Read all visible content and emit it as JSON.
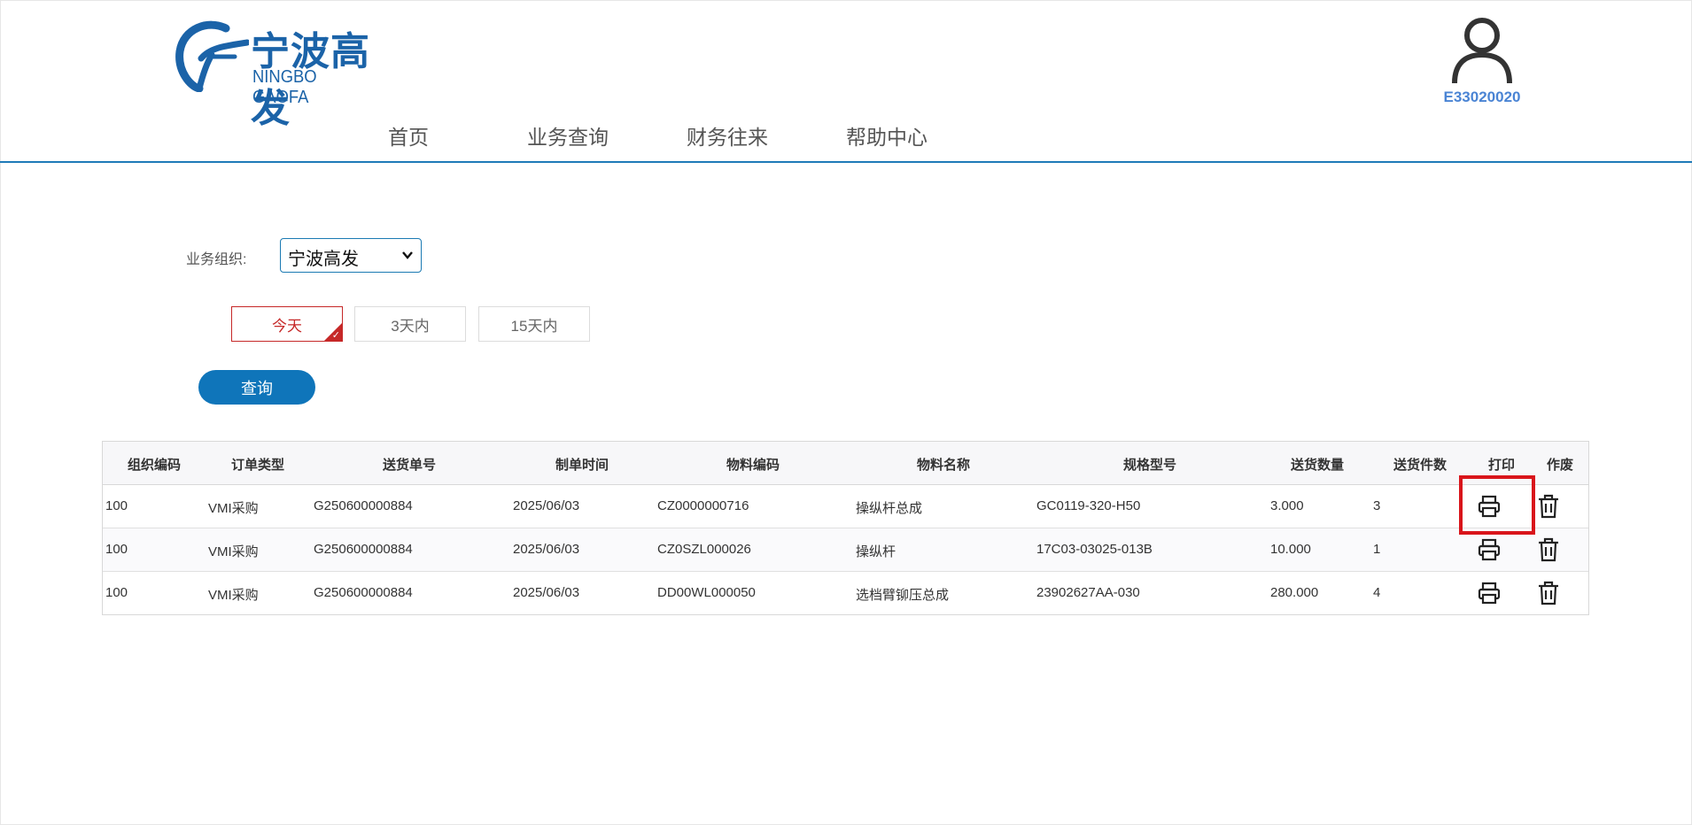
{
  "brand": {
    "name_cn": "宁波高发",
    "name_en": "NINGBO GAOFA",
    "color": "#1b63a8"
  },
  "nav": {
    "items": [
      "首页",
      "业务查询",
      "财务往来",
      "帮助中心"
    ]
  },
  "user": {
    "id": "E33020020"
  },
  "filter": {
    "org_label": "业务组织:",
    "org_selected": "宁波高发",
    "ranges": [
      "今天",
      "3天内",
      "15天内"
    ],
    "active_range": "今天",
    "query_label": "查询"
  },
  "table": {
    "headers": [
      "组织编码",
      "订单类型",
      "送货单号",
      "制单时间",
      "物料编码",
      "物料名称",
      "规格型号",
      "送货数量",
      "送货件数",
      "打印",
      "作废"
    ],
    "rows": [
      [
        "100",
        "VMI采购",
        "G250600000884",
        "2025/06/03",
        "CZ0000000716",
        "操纵杆总成",
        "GC0119-320-H50",
        "3.000",
        "3"
      ],
      [
        "100",
        "VMI采购",
        "G250600000884",
        "2025/06/03",
        "CZ0SZL000026",
        "操纵杆",
        "17C03-03025-013B",
        "10.000",
        "1"
      ],
      [
        "100",
        "VMI采购",
        "G250600000884",
        "2025/06/03",
        "DD00WL000050",
        "选档臂铆压总成",
        "23902627AA-030",
        "280.000",
        "4"
      ]
    ]
  },
  "colors": {
    "accent": "#0f75ba",
    "active": "#c62828",
    "highlight": "#d9151b",
    "user": "#4a84d4"
  }
}
